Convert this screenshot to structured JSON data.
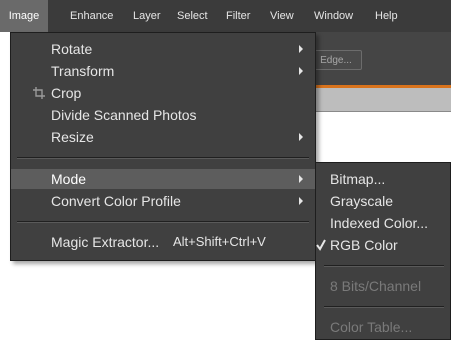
{
  "menubar": {
    "items": [
      {
        "label": "Image",
        "active": true
      },
      {
        "label": "Enhance"
      },
      {
        "label": "Layer"
      },
      {
        "label": "Select"
      },
      {
        "label": "Filter"
      },
      {
        "label": "View"
      },
      {
        "label": "Window"
      },
      {
        "label": "Help"
      }
    ]
  },
  "background": {
    "edge_button_label": "Edge..."
  },
  "image_menu": {
    "items": [
      {
        "label": "Rotate",
        "submenu": true
      },
      {
        "label": "Transform",
        "submenu": true
      },
      {
        "label": "Crop",
        "icon": "crop-icon"
      },
      {
        "label": "Divide Scanned Photos"
      },
      {
        "label": "Resize",
        "submenu": true
      },
      {
        "label": "Mode",
        "submenu": true,
        "highlighted": true
      },
      {
        "label": "Convert Color Profile",
        "submenu": true
      },
      {
        "label": "Magic Extractor...",
        "shortcut": "Alt+Shift+Ctrl+V"
      }
    ]
  },
  "mode_submenu": {
    "items": [
      {
        "label": "Bitmap..."
      },
      {
        "label": "Grayscale"
      },
      {
        "label": "Indexed Color..."
      },
      {
        "label": "RGB Color",
        "checked": true
      },
      {
        "label": "8 Bits/Channel",
        "disabled": true
      },
      {
        "label": "Color Table...",
        "disabled": true
      }
    ]
  },
  "colors": {
    "menubar_bg": "#3b3b3b",
    "menu_bg": "#404040",
    "highlight_bg": "#5d5d5d",
    "text": "#e6e6e6",
    "disabled_text": "#7a7a7a",
    "accent": "#d9731c"
  }
}
